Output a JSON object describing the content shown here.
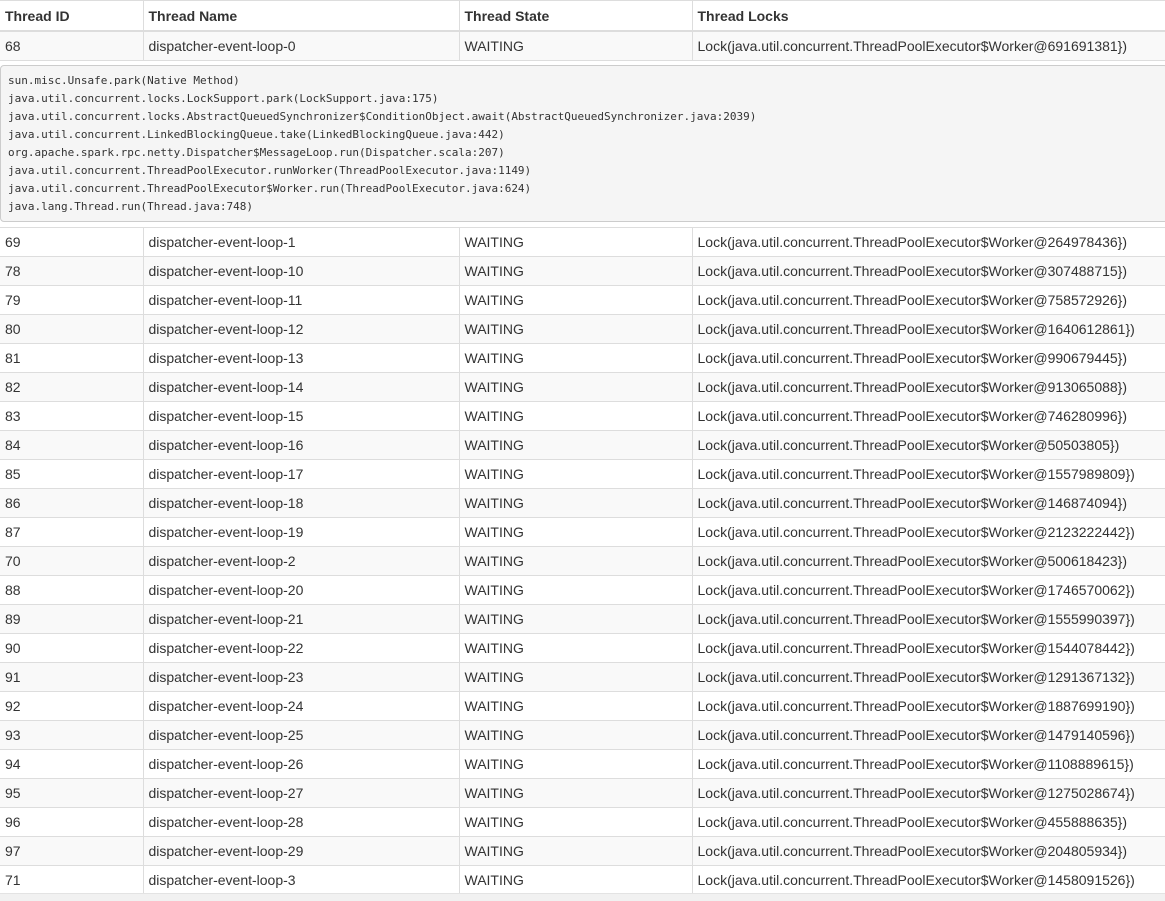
{
  "table": {
    "headers": {
      "id": "Thread ID",
      "name": "Thread Name",
      "state": "Thread State",
      "locks": "Thread Locks"
    },
    "expanded": {
      "id": "68",
      "name": "dispatcher-event-loop-0",
      "state": "WAITING",
      "locks": "Lock(java.util.concurrent.ThreadPoolExecutor$Worker@691691381})",
      "stack_trace": "sun.misc.Unsafe.park(Native Method)\njava.util.concurrent.locks.LockSupport.park(LockSupport.java:175)\njava.util.concurrent.locks.AbstractQueuedSynchronizer$ConditionObject.await(AbstractQueuedSynchronizer.java:2039)\njava.util.concurrent.LinkedBlockingQueue.take(LinkedBlockingQueue.java:442)\norg.apache.spark.rpc.netty.Dispatcher$MessageLoop.run(Dispatcher.scala:207)\njava.util.concurrent.ThreadPoolExecutor.runWorker(ThreadPoolExecutor.java:1149)\njava.util.concurrent.ThreadPoolExecutor$Worker.run(ThreadPoolExecutor.java:624)\njava.lang.Thread.run(Thread.java:748)"
    },
    "rows": [
      {
        "id": "69",
        "name": "dispatcher-event-loop-1",
        "state": "WAITING",
        "locks": "Lock(java.util.concurrent.ThreadPoolExecutor$Worker@264978436})"
      },
      {
        "id": "78",
        "name": "dispatcher-event-loop-10",
        "state": "WAITING",
        "locks": "Lock(java.util.concurrent.ThreadPoolExecutor$Worker@307488715})"
      },
      {
        "id": "79",
        "name": "dispatcher-event-loop-11",
        "state": "WAITING",
        "locks": "Lock(java.util.concurrent.ThreadPoolExecutor$Worker@758572926})"
      },
      {
        "id": "80",
        "name": "dispatcher-event-loop-12",
        "state": "WAITING",
        "locks": "Lock(java.util.concurrent.ThreadPoolExecutor$Worker@1640612861})"
      },
      {
        "id": "81",
        "name": "dispatcher-event-loop-13",
        "state": "WAITING",
        "locks": "Lock(java.util.concurrent.ThreadPoolExecutor$Worker@990679445})"
      },
      {
        "id": "82",
        "name": "dispatcher-event-loop-14",
        "state": "WAITING",
        "locks": "Lock(java.util.concurrent.ThreadPoolExecutor$Worker@913065088})"
      },
      {
        "id": "83",
        "name": "dispatcher-event-loop-15",
        "state": "WAITING",
        "locks": "Lock(java.util.concurrent.ThreadPoolExecutor$Worker@746280996})"
      },
      {
        "id": "84",
        "name": "dispatcher-event-loop-16",
        "state": "WAITING",
        "locks": "Lock(java.util.concurrent.ThreadPoolExecutor$Worker@50503805})"
      },
      {
        "id": "85",
        "name": "dispatcher-event-loop-17",
        "state": "WAITING",
        "locks": "Lock(java.util.concurrent.ThreadPoolExecutor$Worker@1557989809})"
      },
      {
        "id": "86",
        "name": "dispatcher-event-loop-18",
        "state": "WAITING",
        "locks": "Lock(java.util.concurrent.ThreadPoolExecutor$Worker@146874094})"
      },
      {
        "id": "87",
        "name": "dispatcher-event-loop-19",
        "state": "WAITING",
        "locks": "Lock(java.util.concurrent.ThreadPoolExecutor$Worker@2123222442})"
      },
      {
        "id": "70",
        "name": "dispatcher-event-loop-2",
        "state": "WAITING",
        "locks": "Lock(java.util.concurrent.ThreadPoolExecutor$Worker@500618423})"
      },
      {
        "id": "88",
        "name": "dispatcher-event-loop-20",
        "state": "WAITING",
        "locks": "Lock(java.util.concurrent.ThreadPoolExecutor$Worker@1746570062})"
      },
      {
        "id": "89",
        "name": "dispatcher-event-loop-21",
        "state": "WAITING",
        "locks": "Lock(java.util.concurrent.ThreadPoolExecutor$Worker@1555990397})"
      },
      {
        "id": "90",
        "name": "dispatcher-event-loop-22",
        "state": "WAITING",
        "locks": "Lock(java.util.concurrent.ThreadPoolExecutor$Worker@1544078442})"
      },
      {
        "id": "91",
        "name": "dispatcher-event-loop-23",
        "state": "WAITING",
        "locks": "Lock(java.util.concurrent.ThreadPoolExecutor$Worker@1291367132})"
      },
      {
        "id": "92",
        "name": "dispatcher-event-loop-24",
        "state": "WAITING",
        "locks": "Lock(java.util.concurrent.ThreadPoolExecutor$Worker@1887699190})"
      },
      {
        "id": "93",
        "name": "dispatcher-event-loop-25",
        "state": "WAITING",
        "locks": "Lock(java.util.concurrent.ThreadPoolExecutor$Worker@1479140596})"
      },
      {
        "id": "94",
        "name": "dispatcher-event-loop-26",
        "state": "WAITING",
        "locks": "Lock(java.util.concurrent.ThreadPoolExecutor$Worker@1108889615})"
      },
      {
        "id": "95",
        "name": "dispatcher-event-loop-27",
        "state": "WAITING",
        "locks": "Lock(java.util.concurrent.ThreadPoolExecutor$Worker@1275028674})"
      },
      {
        "id": "96",
        "name": "dispatcher-event-loop-28",
        "state": "WAITING",
        "locks": "Lock(java.util.concurrent.ThreadPoolExecutor$Worker@455888635})"
      },
      {
        "id": "97",
        "name": "dispatcher-event-loop-29",
        "state": "WAITING",
        "locks": "Lock(java.util.concurrent.ThreadPoolExecutor$Worker@204805934})"
      },
      {
        "id": "71",
        "name": "dispatcher-event-loop-3",
        "state": "WAITING",
        "locks": "Lock(java.util.concurrent.ThreadPoolExecutor$Worker@1458091526})"
      }
    ]
  }
}
